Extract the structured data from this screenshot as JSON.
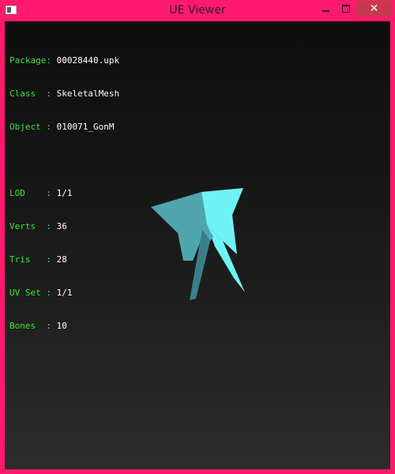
{
  "window": {
    "title": "UE Viewer",
    "close_glyph": "✕"
  },
  "info": {
    "rows_top": [
      {
        "label": "Package:",
        "value": "00028440.upk"
      },
      {
        "label": "Class  :",
        "value": "SkeletalMesh"
      },
      {
        "label": "Object :",
        "value": "010071_GonM"
      }
    ],
    "rows_bottom": [
      {
        "label": "LOD    :",
        "value": "1/1"
      },
      {
        "label": "Verts  :",
        "value": "36"
      },
      {
        "label": "Tris   :",
        "value": "28"
      },
      {
        "label": "UV Set :",
        "value": "1/1"
      },
      {
        "label": "Bones  :",
        "value": "10"
      }
    ]
  },
  "colors": {
    "frame": "#ff1a6e",
    "label_green": "#3ee13e",
    "mesh_light": "#6ff3f7",
    "mesh_mid": "#4fa6ae",
    "mesh_dark": "#3a7f88"
  }
}
